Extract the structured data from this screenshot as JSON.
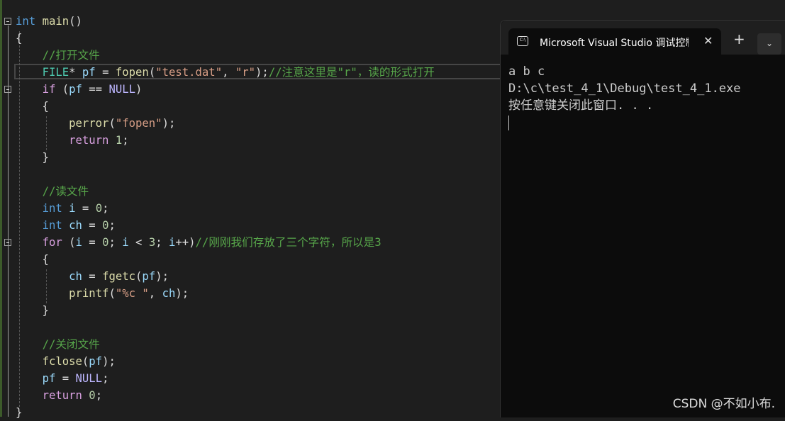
{
  "editor": {
    "lines": [
      [
        [
          "kw",
          "int"
        ],
        [
          "pl",
          " "
        ],
        [
          "fn",
          "main"
        ],
        [
          "pl",
          "()"
        ]
      ],
      [
        [
          "pl",
          "{"
        ]
      ],
      [
        [
          "pl",
          "    "
        ],
        [
          "cm",
          "//打开文件"
        ]
      ],
      [
        [
          "pl",
          "    "
        ],
        [
          "ty",
          "FILE"
        ],
        [
          "pl",
          "* "
        ],
        [
          "var",
          "pf"
        ],
        [
          "pl",
          " = "
        ],
        [
          "fn",
          "fopen"
        ],
        [
          "pl",
          "("
        ],
        [
          "str",
          "\"test.dat\""
        ],
        [
          "pl",
          ", "
        ],
        [
          "str",
          "\"r\""
        ],
        [
          "pl",
          ");"
        ],
        [
          "cm",
          "//注意这里是\"r\"，读的形式打开"
        ]
      ],
      [
        [
          "pl",
          "    "
        ],
        [
          "ctl",
          "if"
        ],
        [
          "pl",
          " ("
        ],
        [
          "var",
          "pf"
        ],
        [
          "pl",
          " == "
        ],
        [
          "mac",
          "NULL"
        ],
        [
          "pl",
          ")"
        ]
      ],
      [
        [
          "pl",
          "    {"
        ]
      ],
      [
        [
          "pl",
          "        "
        ],
        [
          "fn",
          "perror"
        ],
        [
          "pl",
          "("
        ],
        [
          "str",
          "\"fopen\""
        ],
        [
          "pl",
          ");"
        ]
      ],
      [
        [
          "pl",
          "        "
        ],
        [
          "ctl",
          "return"
        ],
        [
          "pl",
          " "
        ],
        [
          "num",
          "1"
        ],
        [
          "pl",
          ";"
        ]
      ],
      [
        [
          "pl",
          "    }"
        ]
      ],
      [
        [
          "pl",
          ""
        ]
      ],
      [
        [
          "pl",
          "    "
        ],
        [
          "cm",
          "//读文件"
        ]
      ],
      [
        [
          "pl",
          "    "
        ],
        [
          "kw",
          "int"
        ],
        [
          "pl",
          " "
        ],
        [
          "var",
          "i"
        ],
        [
          "pl",
          " = "
        ],
        [
          "num",
          "0"
        ],
        [
          "pl",
          ";"
        ]
      ],
      [
        [
          "pl",
          "    "
        ],
        [
          "kw",
          "int"
        ],
        [
          "pl",
          " "
        ],
        [
          "var",
          "ch"
        ],
        [
          "pl",
          " = "
        ],
        [
          "num",
          "0"
        ],
        [
          "pl",
          ";"
        ]
      ],
      [
        [
          "pl",
          "    "
        ],
        [
          "ctl",
          "for"
        ],
        [
          "pl",
          " ("
        ],
        [
          "var",
          "i"
        ],
        [
          "pl",
          " = "
        ],
        [
          "num",
          "0"
        ],
        [
          "pl",
          "; "
        ],
        [
          "var",
          "i"
        ],
        [
          "pl",
          " < "
        ],
        [
          "num",
          "3"
        ],
        [
          "pl",
          "; "
        ],
        [
          "var",
          "i"
        ],
        [
          "pl",
          "++)"
        ],
        [
          "cm",
          "//刚刚我们存放了三个字符，所以是3"
        ]
      ],
      [
        [
          "pl",
          "    {"
        ]
      ],
      [
        [
          "pl",
          "        "
        ],
        [
          "var",
          "ch"
        ],
        [
          "pl",
          " = "
        ],
        [
          "fn",
          "fgetc"
        ],
        [
          "pl",
          "("
        ],
        [
          "var",
          "pf"
        ],
        [
          "pl",
          ");"
        ]
      ],
      [
        [
          "pl",
          "        "
        ],
        [
          "fn",
          "printf"
        ],
        [
          "pl",
          "("
        ],
        [
          "str",
          "\"%c \""
        ],
        [
          "pl",
          ", "
        ],
        [
          "var",
          "ch"
        ],
        [
          "pl",
          ");"
        ]
      ],
      [
        [
          "pl",
          "    }"
        ]
      ],
      [
        [
          "pl",
          ""
        ]
      ],
      [
        [
          "pl",
          "    "
        ],
        [
          "cm",
          "//关闭文件"
        ]
      ],
      [
        [
          "pl",
          "    "
        ],
        [
          "fn",
          "fclose"
        ],
        [
          "pl",
          "("
        ],
        [
          "var",
          "pf"
        ],
        [
          "pl",
          ");"
        ]
      ],
      [
        [
          "pl",
          "    "
        ],
        [
          "var",
          "pf"
        ],
        [
          "pl",
          " = "
        ],
        [
          "mac",
          "NULL"
        ],
        [
          "pl",
          ";"
        ]
      ],
      [
        [
          "pl",
          "    "
        ],
        [
          "ctl",
          "return"
        ],
        [
          "pl",
          " "
        ],
        [
          "num",
          "0"
        ],
        [
          "pl",
          ";"
        ]
      ],
      [
        [
          "pl",
          "}"
        ]
      ]
    ]
  },
  "terminal": {
    "tab_icon": "console-icon",
    "tab_icon_text": "C:\\",
    "tab_title": "Microsoft Visual Studio 调试控制台",
    "close": "✕",
    "plus": "+",
    "dropdown": "⌄",
    "output": [
      "a b c",
      "D:\\c\\test_4_1\\Debug\\test_4_1.exe",
      "按任意键关闭此窗口. . ."
    ]
  },
  "watermark": "CSDN @不如小布."
}
